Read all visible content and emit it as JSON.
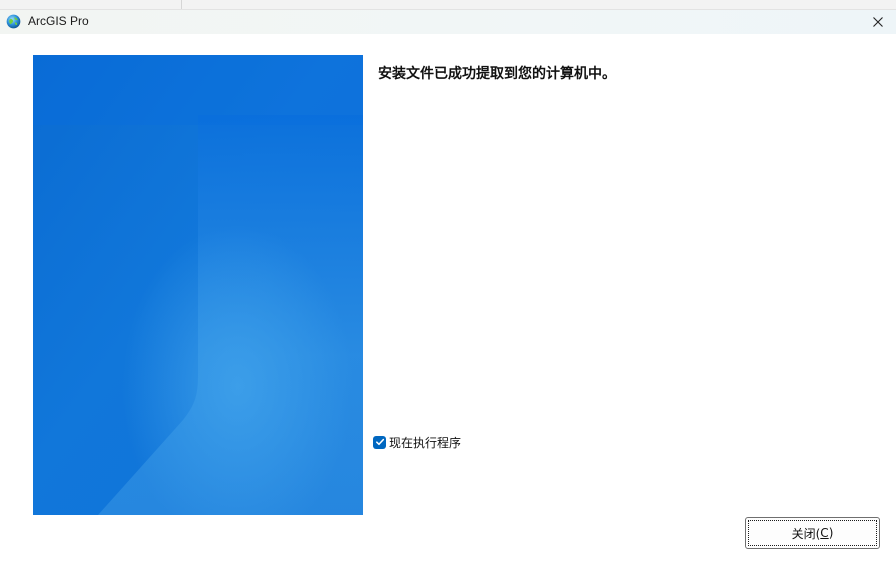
{
  "window": {
    "title": "ArcGIS Pro"
  },
  "content": {
    "message": "安装文件已成功提取到您的计算机中。",
    "run_checkbox": {
      "label": "现在执行程序",
      "checked": true
    }
  },
  "buttons": {
    "close_prefix": "关闭(",
    "close_mnemonic": "C",
    "close_suffix": ")"
  },
  "colors": {
    "accent": "#0067c0",
    "banner_dark": "#0a6fd6",
    "banner_light": "#3a9ae6"
  },
  "icons": {
    "app": "arcgis-globe-icon",
    "close": "close-icon",
    "check": "check-icon"
  }
}
